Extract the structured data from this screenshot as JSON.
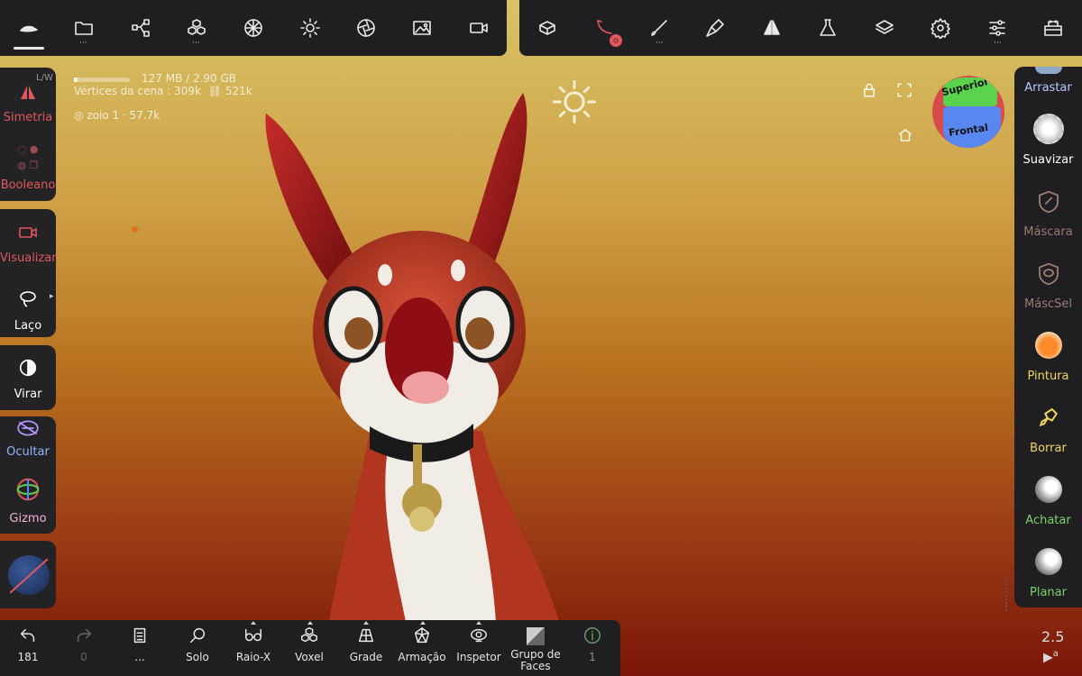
{
  "top_toolbar_left": {
    "active_underline": true
  },
  "stats": {
    "memory": "127 MB / 2.90 GB",
    "vertices_label": "Vértices da cena :",
    "vertices_value": "309k",
    "faces_value": "521k",
    "object_name": "zoio 1",
    "object_count": "57.7k"
  },
  "left_panel": {
    "lw": "L/W",
    "symmetry": "Simetria",
    "boolean": "Booleano",
    "view": "Visualizar",
    "lasso": "Laço",
    "flip": "Virar",
    "hide": "Ocultar",
    "gizmo": "Gizmo"
  },
  "right_panel": {
    "drag": "Arrastar",
    "smooth": "Suavizar",
    "mask": "Máscara",
    "masksel": "MáscSel",
    "paint": "Pintura",
    "smudge": "Borrar",
    "flatten": "Achatar",
    "plane": "Planar"
  },
  "gizmo_cube": {
    "top": "Superior",
    "front": "Frontal"
  },
  "bottom_toolbar": {
    "undo_count": "181",
    "redo_count": "0",
    "more": "...",
    "solo": "Solo",
    "xray": "Raio-X",
    "voxel": "Voxel",
    "grid": "Grade",
    "wireframe": "Armação",
    "inspector": "Inspetor",
    "facegroup": "Grupo de Faces",
    "info_count": "1"
  },
  "corner": {
    "version": "2.5",
    "letter": "a"
  },
  "colors": {
    "panel": "#1f1f21",
    "accent_red": "#e0565b",
    "accent_yellow": "#f2d45c",
    "accent_green": "#7cd26a",
    "accent_blue": "#8fb4ff",
    "accent_purple": "#b595ff"
  }
}
